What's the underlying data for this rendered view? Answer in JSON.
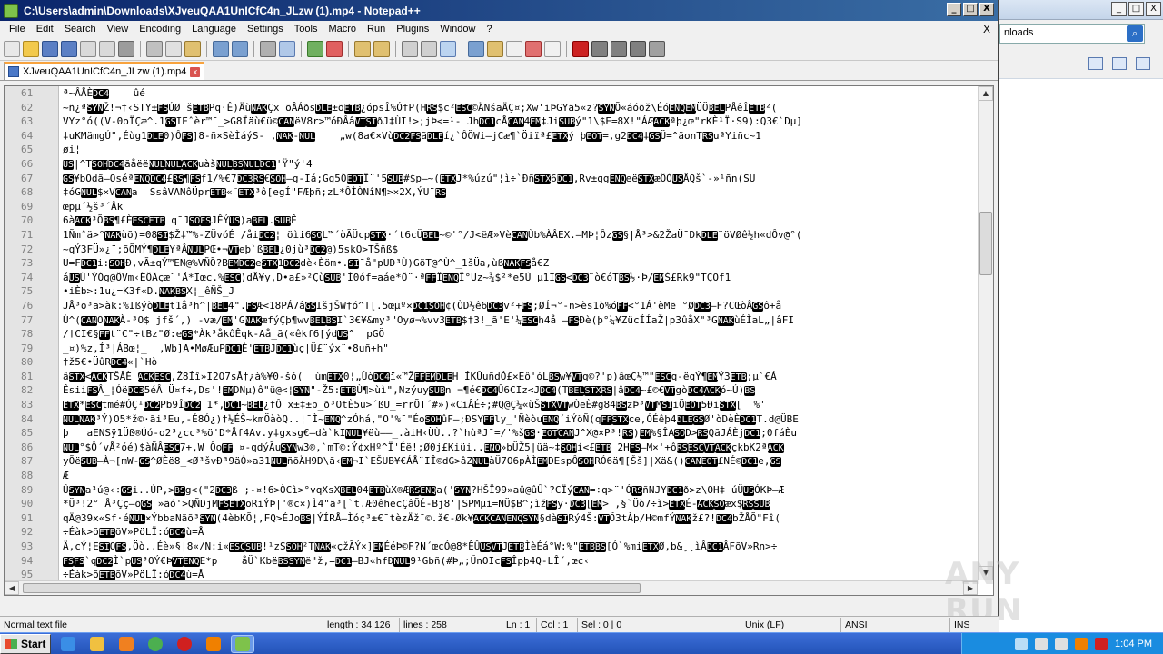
{
  "window": {
    "title": "C:\\Users\\admin\\Downloads\\XJveuQAA1UnICfC4n_JLzw (1).mp4 - Notepad++",
    "min": "_",
    "max": "□",
    "close": "X"
  },
  "menu": [
    "File",
    "Edit",
    "Search",
    "View",
    "Encoding",
    "Language",
    "Settings",
    "Tools",
    "Macro",
    "Run",
    "Plugins",
    "Window",
    "?"
  ],
  "menu_close": "X",
  "tab": {
    "label": "XJveuQAA1UnICfC4n_JLzw (1).mp4",
    "close": "x"
  },
  "editor": {
    "lines": [
      {
        "n": "61",
        "text": "ª~ÂÅÈDC4    ûé"
      },
      {
        "n": "62",
        "text": "~ñ¿ªSYNŽ!¬†‹STY±FSÚØ¯šETBPq·Ê)ÄùNAKÇx õÂÁðsDLE±õETB¿ópsÎ%ÓfP(HRS$c²ESC©ÄNšaÄÇ¤;Xw'iÞGYä5«z?SYNÕ«áóõž\\ÉóENQEMÜÖBELPÅêÎETB²("
      },
      {
        "n": "63",
        "text": "VYz°ó((V-0oÏÇæ^.1GSIEˆèr™¯_>G8Ïäù€ü©CANëV8r>™óÐÂâVTSIðJ‡ÙI!>;jÞ<=¹- JhDC1cÅCAN4EM‡JiSUBý\"1\\$E=8X!\"ÁÆACKªþ¿œ\"rKÈ¹Ï·S9):Q3€`Dµ]"
      },
      {
        "n": "64",
        "text": "‡uKMämgÚ\",Éùg1DLE0)ÔFS]8-ñ×SèÌáýS- ,NAK-NUL    „w(8a€×VùDC2FSãDLEí¿`ÔÖWi—jCæ¶`Öiïª£ETXý þEOT=,g2DC4‡GSÜ=^ãonTRSuªYiñc~1"
      },
      {
        "n": "65",
        "text": "øi¦"
      },
      {
        "n": "66",
        "text": "US|^TSOHDC4ãåëëNULNULACKuàšNULBSNULDC1'Ÿ\"ý'4"
      },
      {
        "n": "67",
        "text": "GS¥bOdã—ÖséªENQDC4£RS¶FSf1/%€7DC3RS€SOH—g-Iá;Gg5ÕEOTÏ¨'5SUB#$p—~(ETXJ*%úzú\"¦ì÷`ÐñSTX6DC1,Rv±ggENQeëSTXæÔÒUSÅQš`-»¹ñn(SU"
      },
      {
        "n": "68",
        "text": "‡óGNUL$×VCANa  SsâVANôÜprETB«¨ETX³ô[egÍ\"FÆþñ;zL*ÔÌÒNîN¶>×2X,ÝU¨RS"
      },
      {
        "n": "69",
        "text": "œpµ´½š³´Âk"
      },
      {
        "n": "70",
        "text": "6àACK³ÕBS¶£ÈESCETB q¯JSOFSJÊÝUS)aBEL.SUBÊ"
      },
      {
        "n": "71",
        "text": "1Ñmˆä>°NAKùõ)=08SI$Ž‡™%-ZÜvóÉ /åiDC2¦ öìi6SOL™´òÃÜcpSTX·´t6cÜBEL~©'°/J<ëÆ»VèCANÙb%ÀÂEX.—MÞ¦ÔzGS§|Å³>&2ŽaÜ¯DkDLE¨öVØê½h«dÔv@°("
      },
      {
        "n": "72",
        "text": "~qÝ3FÜ»¿¨;õÕMÝ¶DLEYªÂNULPŒ•¬VTeþ`ßBEL¿0jù³DC2@)5skO>TŠñß$"
      },
      {
        "n": "73",
        "text": "U=FDC1i:SOHÐ,vÃ±qÝ™EN@%VÑÕ?BEMDC2eSTX1DC2dè‹Èöm•.SI¯å\"pUD³Ù)GöT@^Ù^_1šÜa,ùßNAKFSå€Z"
      },
      {
        "n": "74",
        "text": "áUSÚ'ÝÓg@ÔVm‹ÊÔÃçæ¨'Å*Iœc.%ESC)dÅ¥y,D•a£»²ÇùSUB'Ì0óf=aáe*Ô¨·ªFFÏENQÎ°Üz~¾$²*e5Ù µ1IGS<DC3¨ò€óTBS½·Þ/EMŠ£Rk9\"TÇÖf1"
      },
      {
        "n": "75",
        "text": "•iÈb>:1u¿=K3f«D.NAKBSX¦_êÑŠ_J"
      },
      {
        "n": "76",
        "text": "JÅ³o³a>àk:%IßýòDLEt1å³h^|BEL4\".FSÆ<18PÁ7âGSIšjŠW†ó^T[.5œµº×DC1SOH¢(ÒD½ê6DC3v²+FS;ØÍ¬°-n>ès1ò%óFF<°1Á'èMë¨°ØDC3—F?CŒòÂGSô+å"
      },
      {
        "n": "77",
        "text": "Ù^(CANONAKÀ-³O$ jfš´,) -væ/EM'GNAKæfýÇþ¶wvBELBSI`3€¥&my³\"Oyø¬%vv3ETB$†3!_ã'E'¼ESCh4å —FSÐè(þ°¼¥ZücÍÍaŽ|p3ûåX\"³GNAKùÉÌaL„|âFI"
      },
      {
        "n": "78",
        "text": "/†CI€§FFt¨C\"÷tBz\"Ø:eGS*Àk³åkôÊqk-Aå_ã(«êkf6[ýdUS^  pGÖ"
      },
      {
        "n": "79",
        "text": "_¤)%z,Í³|ÁBœ¦_  ,Wb]A•MøÆuPDC1È'ETBJDC1ùç|Ü£¨ýx¨•8uñ+h\""
      },
      {
        "n": "80",
        "text": "†ž5€•ÜûRDC4«|`Hò"
      },
      {
        "n": "81",
        "text": "âSTX<ACKTŠÂÈ ACKESC,Ž8Íî»I2O7sÅ†¿à%¥0-šó(  ùmETX0¦„ÙòDC4ï«™ŽFFEMDLEH ÍKÛuñdÓ£×Eô'óLBSw¥VTq©?'p)âœÇ½™\"ESCq-ëqÝ¶EMÝ3ETB;µ`€Á"
      },
      {
        "n": "82",
        "text": "ÊsiiFSÂ_¦ÓëDC35éÂ Ü¤f÷,Ds'!EMDNµ)ô\"ü@<¦SYN\"-Ž5:ETBÙ¶>ùì\",NzýuySUBn ¬¶é€DC4Û6CIz<JDC4(TBELSTXRS|âDC4~£©€VTgòDC4ACKó~Ú)BS"
      },
      {
        "n": "83",
        "text": "ETX*ESCtmé#ÓÇ¹DC2Pb9ÎDC2 1*,DC1~BEL¿fÔ x±‡±þ_ð³OtÈ5u>´ßU_=rrÕT´#»)«CiÂÉ÷;#Q@Ç¼«ùŠSTXVTwÒeÈ#g84BSzÞ³VTMSIiÕEOT5ÐiSTX[¯¨%'"
      },
      {
        "n": "84",
        "text": "NULNAK³Ý)O5*ž©·ãi³Eu,-É8Ó¿)†½ÉŠ~kmÖàòQ..¦¯Ì~ENQ^zÓhá,\"O'%¯\"ÉoSOHûF—;ÐSYFFly_'Ñèòu­ENQ´iÝöÑ(qFFSTXce,ÓÉêþ4DLEGSØ'òDèÈDC1T.d@ÜBE"
      },
      {
        "n": "85",
        "text": "þ   aENSÿ1Üß®Úó-o2³¿cc³%ö'D*Åf4Av.y‡gxsg€—dà`kINUL¥ëù——_.àiH‹ÜÙ..?`hùªJ¯=/'%šGS·EOTCANJ^X@×P³!RS)EM%§ÎASOD>RSQãJÁÈjDC1;0fáÈu"
      },
      {
        "n": "86",
        "text": "NUL°$Ô´vÅ²óé)$àÑÂESC7+,W ÔoFF ¤-qdýÃuSYNw3®,`mT©:Ý¢xHº^Ï'Éë!;Ø0j£Kiüi..ENQ»bÜŽ5|üä~‡SOHí<£ETB 2HFS—M×'+ôRSESCVTACKçkbK2ªACK"
      },
      {
        "n": "87",
        "text": "yÕëSUB—À¬[mW-GS^ØÈë8_<Ø³švÐ³9äÓ»a31NULñõÄH9D\\ã‹EM¬I`EŠUB¥€ÁÅ¨IÎ©dG>âZNULàÜ7O6pÀÌEMDEspÔSOHRÓ6ä¶[Šš]|Xä&()CANEOT£NÉ©DC1e,GS"
      },
      {
        "n": "88",
        "text": "Æ"
      },
      {
        "n": "89",
        "text": "ÛSYNa³ú@‹÷GSi..ÚP,>BSg<(\"2DC3ß ;-¤!6>ÒCì>°vqXsXBEL04ETBùX®ÆRSENQa('SYN?HŠÏ99»aû@ûÛ`?CÏýCAN=÷q>¨'ÓRSñNJYDC1ð>z\\OH‡ úÜUSÓKÞ—Æ"
      },
      {
        "n": "90",
        "text": "*Ü³!2°¯Å³Çç—öGS¨»ãó'>QÑDjMFSETXoRiÝÞ|'®c×)Ì4\"ã³[`t.Æ0êhecÇâÕÉ-Bj8'|SPMµi=NÜ$B^;ìžFSy·DC3[EM>¨,§`Üò7÷ì>ETXÉ-ACKSOæx$RSSUB"
      },
      {
        "n": "91",
        "text": "qÄ@39x«Sf·éNUL×ÝbbaNãõ³SYN(4èbKÕ¦,FQ>ÉJoBS|ÝÍRÅ—Ìóç³±€¯tèzÄž¯©.ž€-Øk¥ACKCANENQSYN§dàSIRý4Š:VTÖ3tÀþ/H©mfÝNAKž£?!DC4bŽÅÕ\"Fî("
      },
      {
        "n": "92",
        "text": "÷Éàk>õETBõV»PöLÏ:óDC4ù=Å"
      },
      {
        "n": "93",
        "text": "Ä,cÝ¦ESIOFS,Öò..Éè»§|8«/N:i«ESCSUB!¹zSSOH²TNAK«çžÃÝ×]EMÉéÞ©F?N´œcÓ@8*ÊÛUSVTJETBÌèÉá°W:%\"ETBBS[Ó`%miETXØ,b&¸¸ìÂDC1ÂFõV»Rn>÷"
      },
      {
        "n": "94",
        "text": "FSFS`qDC2Ì`pUS³OÝ€ÞVTENQE*p    åÜ`KbëBSSYNë\"ž,=DC1—BJ«hfÐNUL9¹Gbñ(#Þ„;ÜnOIcFSÎpþ4Q-LÎ´,œc‹"
      },
      {
        "n": "95",
        "text": "÷Éàk>õETBõV»PöLÏ:óDC4ù=Å"
      }
    ]
  },
  "status": {
    "type": "Normal text file",
    "length": "length : 34,126",
    "lines": "lines : 258",
    "ln": "Ln : 1",
    "col": "Col : 1",
    "sel": "Sel : 0 | 0",
    "eol": "Unix (LF)",
    "encoding": "ANSI",
    "mode": "INS"
  },
  "bg_window": {
    "address": "nloads",
    "min": "_",
    "max": "□",
    "close": "X"
  },
  "watermark": "ANY RUN",
  "taskbar": {
    "start": "Start",
    "clock": "1:04 PM"
  },
  "colors": {
    "title_gradient_start": "#0a246a",
    "title_gradient_end": "#3a6ea5",
    "control_char_bg": "#000000",
    "control_char_fg": "#ffffff",
    "tab_accent": "#f8a33e",
    "tray": "#1a8ce0"
  }
}
